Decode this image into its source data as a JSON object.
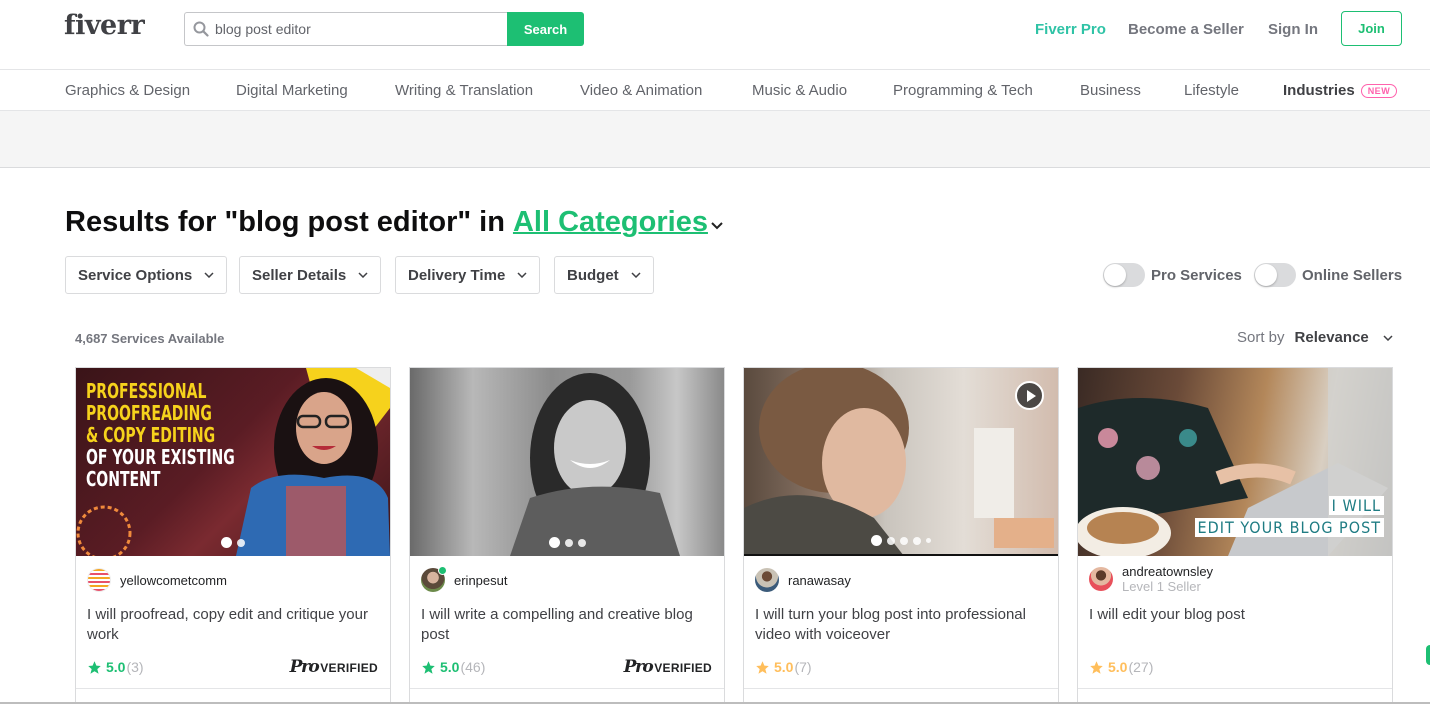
{
  "header": {
    "logo": "fiverr",
    "search": {
      "value": "blog post editor",
      "button_label": "Search"
    },
    "links": {
      "pro": "Fiverr Pro",
      "seller": "Become a Seller",
      "signin": "Sign In",
      "join": "Join"
    }
  },
  "categories": [
    "Graphics & Design",
    "Digital Marketing",
    "Writing & Translation",
    "Video & Animation",
    "Music & Audio",
    "Programming & Tech",
    "Business",
    "Lifestyle",
    "Industries"
  ],
  "industries_badge": "NEW",
  "results": {
    "prefix": "Results for \"blog post editor\" in",
    "category_link": "All Categories"
  },
  "filters": [
    "Service Options",
    "Seller Details",
    "Delivery Time",
    "Budget"
  ],
  "toggles": {
    "pro": "Pro Services",
    "online": "Online Sellers",
    "pro_on": false,
    "online_on": false
  },
  "services_count": "4,687 Services Available",
  "sort": {
    "label": "Sort by",
    "value": "Relevance"
  },
  "colors": {
    "brand": "#1dbf73",
    "pro": "#2fc3a6",
    "rating_gold": "#ffbe5b",
    "badge_pink": "#ff62ad"
  },
  "gigs": [
    {
      "seller": "yellowcometcomm",
      "level": "",
      "online": false,
      "title": "I will proofread, copy edit and critique your work",
      "rating": "5.0",
      "reviews": "(3)",
      "pro_verified": true,
      "pro_text": "Pro",
      "verified_text": "VERIFIED",
      "thumb_text": [
        "PROFESSIONAL",
        "PROOFREADING",
        "& COPY EDITING",
        "OF YOUR EXISTING",
        "CONTENT"
      ],
      "slides": 2,
      "video": false
    },
    {
      "seller": "erinpesut",
      "level": "",
      "online": true,
      "title": "I will write a compelling and creative blog post",
      "rating": "5.0",
      "reviews": "(46)",
      "pro_verified": true,
      "pro_text": "Pro",
      "verified_text": "VERIFIED",
      "slides": 3,
      "video": false
    },
    {
      "seller": "ranawasay",
      "level": "",
      "online": false,
      "title": "I will turn your blog post into professional video with voiceover",
      "rating": "5.0",
      "reviews": "(7)",
      "pro_verified": false,
      "slides": 5,
      "video": true
    },
    {
      "seller": "andreatownsley",
      "level": "Level 1 Seller",
      "online": false,
      "title": "I will edit your blog post",
      "rating": "5.0",
      "reviews": "(27)",
      "pro_verified": false,
      "thumb_text": [
        "I WILL",
        "EDIT YOUR BLOG POST"
      ],
      "slides": 0,
      "video": false
    }
  ]
}
